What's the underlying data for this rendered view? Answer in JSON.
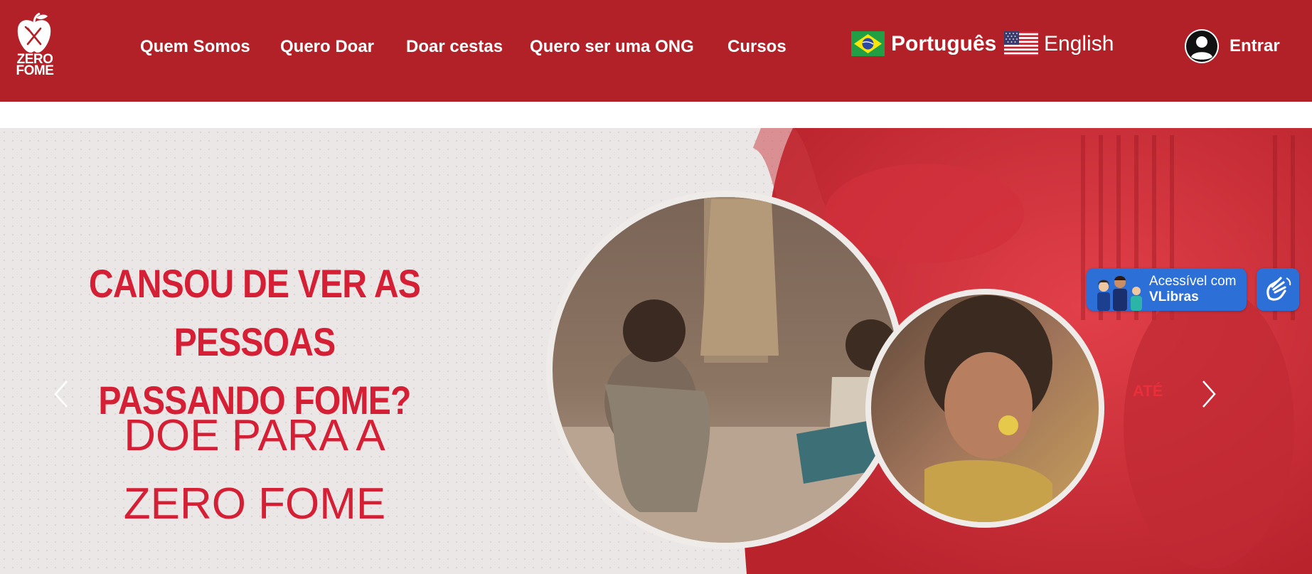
{
  "brand": {
    "logo_line1": "ZERO",
    "logo_line2": "FOME"
  },
  "nav": {
    "items": [
      {
        "label": "Quem Somos"
      },
      {
        "label": "Quero Doar"
      },
      {
        "label": "Doar cestas"
      },
      {
        "label": "Quero ser uma ONG"
      },
      {
        "label": "Cursos"
      }
    ]
  },
  "languages": [
    {
      "label": "Português",
      "flag_icon": "brazil-flag-icon"
    },
    {
      "label": "English",
      "flag_icon": "usa-flag-icon"
    }
  ],
  "account": {
    "login_label": "Entrar",
    "icon": "user-avatar-icon"
  },
  "hero": {
    "headline_line1": "CANSOU DE VER AS PESSOAS",
    "headline_line2": "PASSANDO FOME?",
    "subline_line1": "DOE PARA A",
    "subline_line2": "ZERO FOME",
    "background_label": "ATÉ",
    "prev_icon": "chevron-left-icon",
    "next_icon": "chevron-right-icon"
  },
  "vlibras": {
    "line1": "Acessível com",
    "line2": "VLibras",
    "hand_icon": "sign-language-hand-icon"
  },
  "colors": {
    "brand_red": "#b22127",
    "headline_red": "#d41f35",
    "hero_bg": "#ebe7e7",
    "vlibras_blue": "#2c6fd6"
  }
}
